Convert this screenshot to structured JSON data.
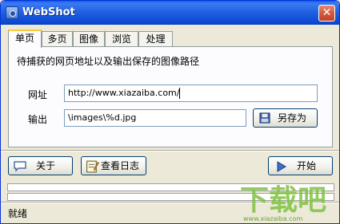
{
  "window": {
    "title": "WebShot",
    "close_glyph": "✕"
  },
  "tabs": [
    {
      "label": "单页",
      "active": true
    },
    {
      "label": "多页"
    },
    {
      "label": "图像"
    },
    {
      "label": "浏览"
    },
    {
      "label": "处理"
    }
  ],
  "panel": {
    "description": "待捕获的网页地址以及输出保存的图像路径",
    "url_label": "网址",
    "url_value": "http://www.xiazaiba.com/",
    "output_label": "输出",
    "output_value": "\\images\\%d.jpg",
    "save_as_label": "另存为"
  },
  "buttons": {
    "about_label": "关于",
    "log_label": "查看日志",
    "start_label": "开始"
  },
  "status": {
    "text": "就绪"
  },
  "watermark": {
    "big": "下载吧",
    "small": "www.xiazaiba.com"
  },
  "icons": {
    "app": "webshot-app-icon",
    "about": "speech-bubble-icon",
    "log": "notepad-icon",
    "save": "floppy-disk-icon",
    "start": "play-icon"
  },
  "colors": {
    "titlebar": "#0a5fe8",
    "close": "#d35a3c",
    "tab_highlight": "#ffc83c",
    "watermark": "#7fc241"
  }
}
